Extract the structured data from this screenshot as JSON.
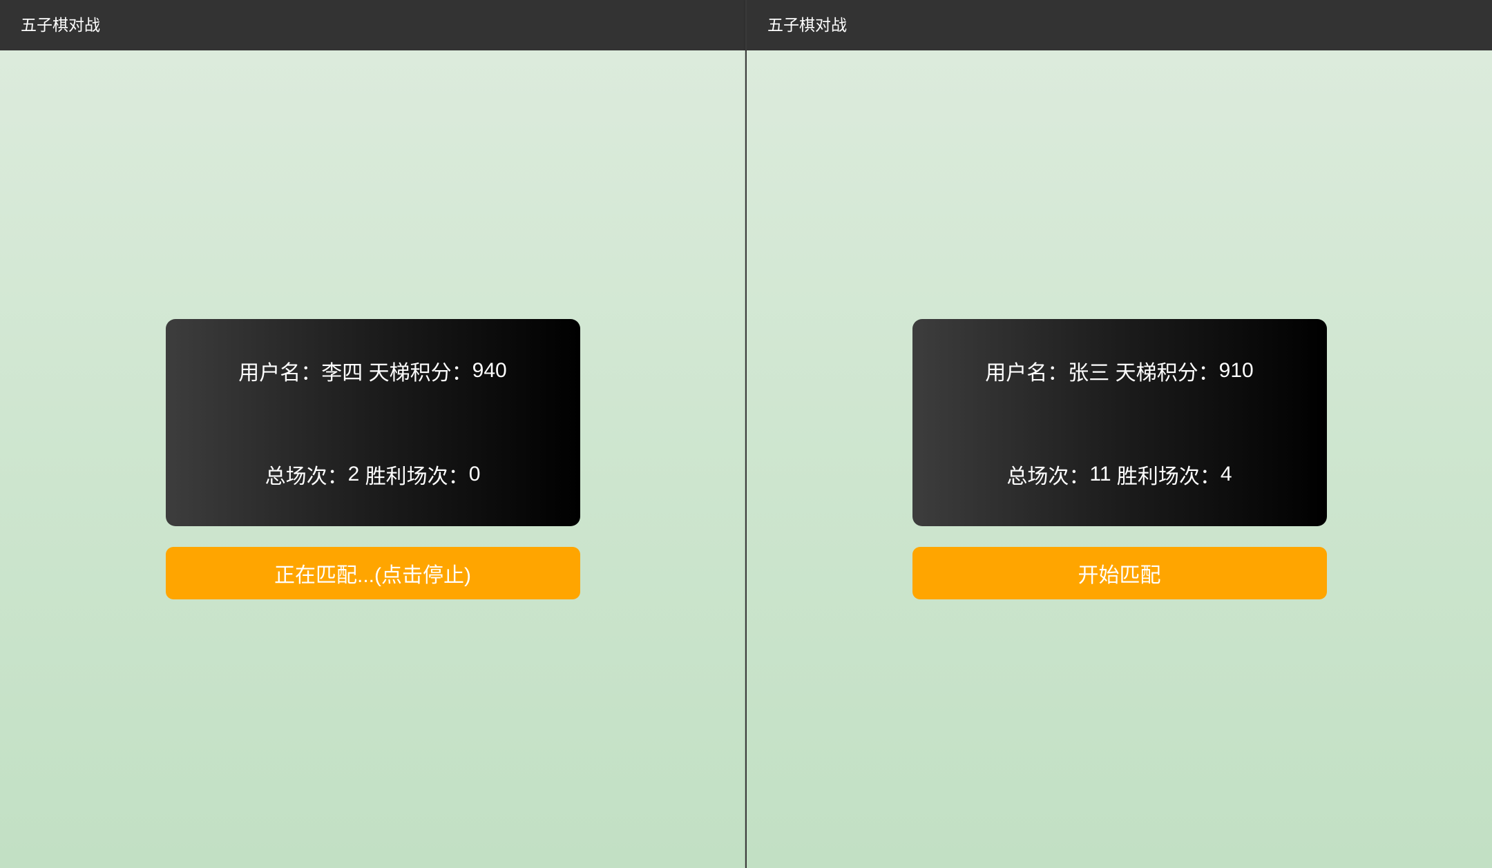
{
  "colors": {
    "header_bg": "#333333",
    "body_gradient_top": "#dcebdc",
    "body_gradient_bottom": "#c2e0c4",
    "card_gradient_from": "#3d3d3d",
    "card_gradient_to": "#000000",
    "button_bg": "#ffa500",
    "text": "#ffffff"
  },
  "windows": [
    {
      "app_title": "五子棋对战",
      "user_info": {
        "username_label": "用户名：",
        "username": "李四",
        "score_label": "天梯积分：",
        "score": "940",
        "total_label": "总场次：",
        "total": "2",
        "wins_label": "胜利场次：",
        "wins": "0"
      },
      "match_button": {
        "label": "正在匹配...(点击停止)"
      }
    },
    {
      "app_title": "五子棋对战",
      "user_info": {
        "username_label": "用户名：",
        "username": "张三",
        "score_label": "天梯积分：",
        "score": "910",
        "total_label": "总场次：",
        "total": "11",
        "wins_label": "胜利场次：",
        "wins": "4"
      },
      "match_button": {
        "label": "开始匹配"
      }
    }
  ]
}
